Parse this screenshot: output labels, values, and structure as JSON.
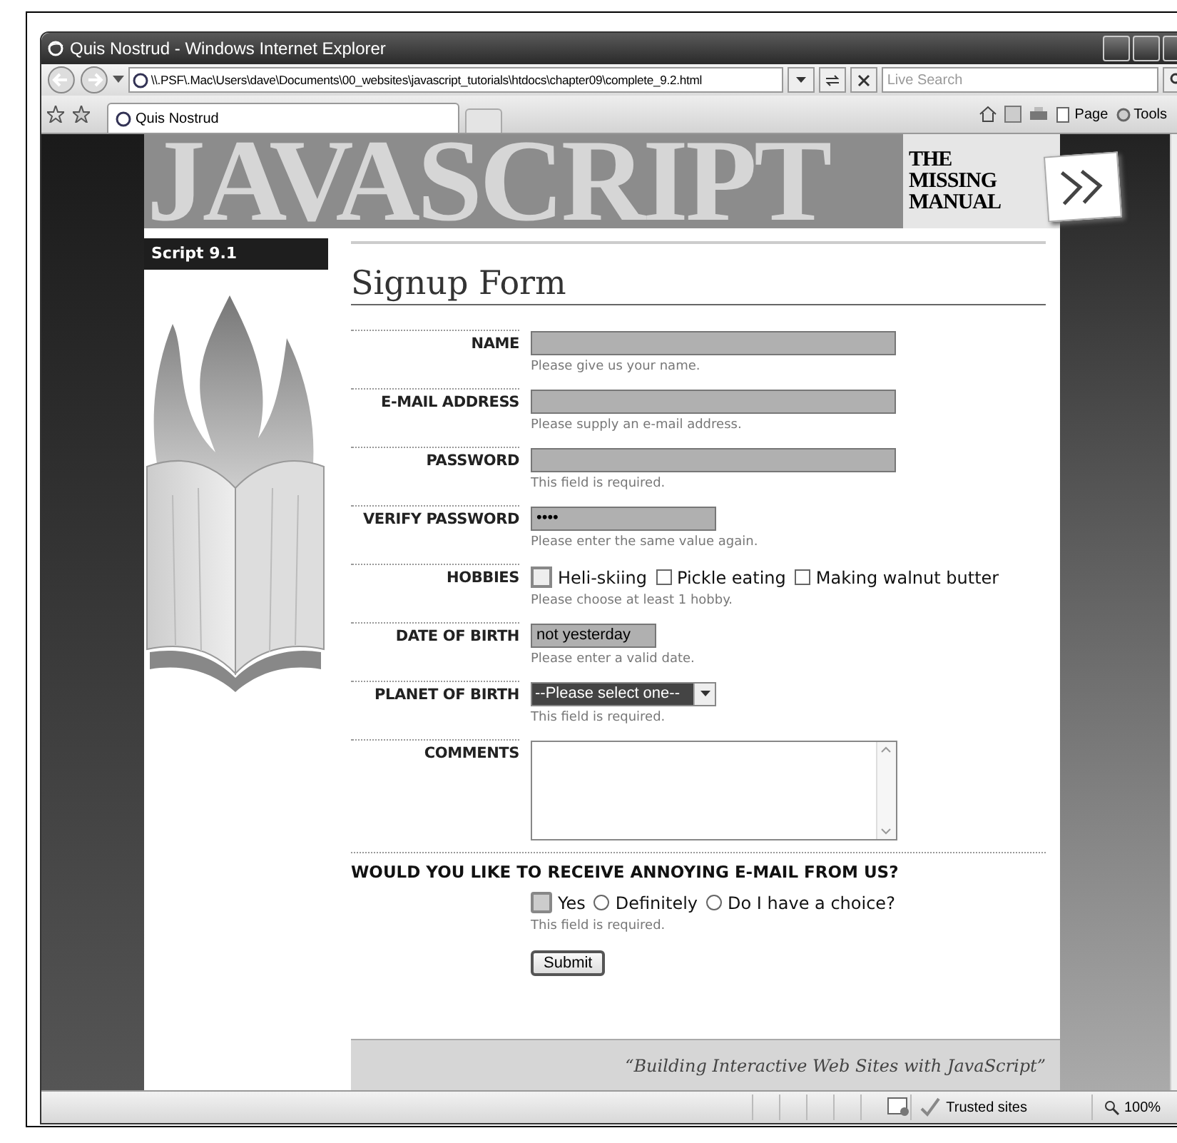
{
  "window": {
    "title": "Quis Nostrud - Windows Internet Explorer"
  },
  "address_bar": {
    "url": "\\\\.PSF\\.Mac\\Users\\dave\\Documents\\00_websites\\javascript_tutorials\\htdocs\\chapter09\\complete_9.2.html"
  },
  "search": {
    "placeholder": "Live Search"
  },
  "tabs": [
    {
      "label": "Quis Nostrud",
      "selected": true
    }
  ],
  "command_bar": [
    "Page",
    "Tools"
  ],
  "banner": {
    "title": "JAVASCRIPT",
    "subtitle": [
      "THE",
      "MISSING",
      "MANUAL"
    ]
  },
  "sidebar": {
    "label": "Script 9.1"
  },
  "form": {
    "title": "Signup Form",
    "fields": [
      {
        "kind": "text",
        "label": "NAME",
        "invalid": true,
        "error": "Please give us your name."
      },
      {
        "kind": "text",
        "label": "E-MAIL ADDRESS",
        "invalid": true,
        "error": "Please supply an e-mail address."
      },
      {
        "kind": "password",
        "label": "PASSWORD",
        "invalid": true,
        "error": "This field is required."
      },
      {
        "kind": "password",
        "label": "VERIFY PASSWORD",
        "value": "••••",
        "invalid": true,
        "error": "Please enter the same value again."
      },
      {
        "kind": "checkboxes",
        "label": "HOBBIES",
        "options": [
          {
            "label": "Heli-skiing",
            "checked": false,
            "focused": true
          },
          {
            "label": "Pickle eating",
            "checked": false,
            "focused": false
          },
          {
            "label": "Making walnut butter",
            "checked": false,
            "focused": false
          }
        ],
        "error": "Please choose at least 1 hobby."
      },
      {
        "kind": "text",
        "label": "DATE OF BIRTH",
        "value": "not yesterday",
        "invalid": true,
        "error": "Please enter a valid date."
      },
      {
        "kind": "select",
        "label": "PLANET OF BIRTH",
        "value": "--Please select one--",
        "invalid": true,
        "error": "This field is required."
      },
      {
        "kind": "textarea",
        "label": "COMMENTS",
        "invalid": false
      }
    ],
    "question": {
      "label": "WOULD YOU LIKE TO RECEIVE ANNOYING E-MAIL FROM US?",
      "options": [
        {
          "label": "Yes",
          "selected": false,
          "focused": true
        },
        {
          "label": "Definitely",
          "selected": false,
          "focused": false
        },
        {
          "label": "Do I have a choice?",
          "selected": false,
          "focused": false
        }
      ],
      "error": "This field is required."
    },
    "submit": "Submit"
  },
  "footer": {
    "quote": "“Building Interactive Web Sites with JavaScript”"
  },
  "status_bar": {
    "zone": "Trusted sites",
    "zoom": "100%"
  }
}
